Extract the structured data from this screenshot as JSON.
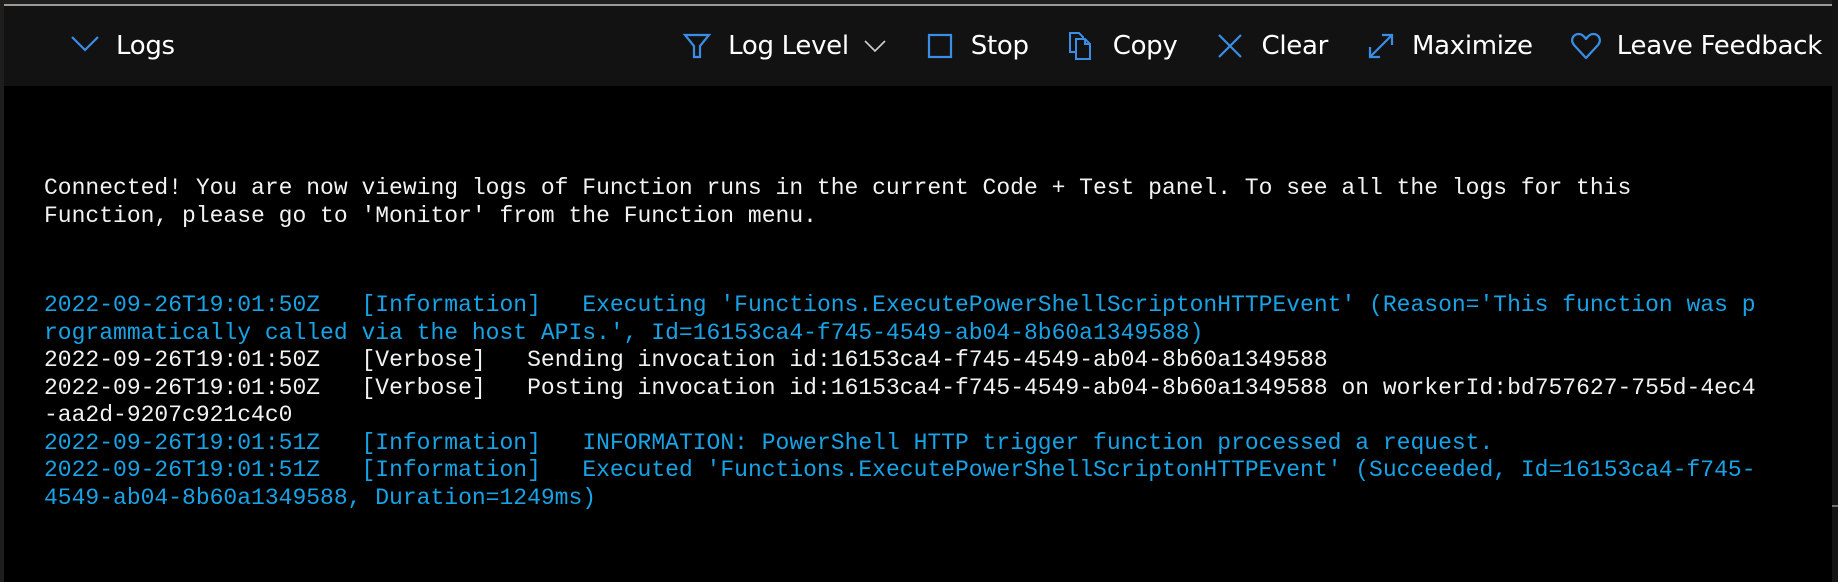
{
  "toolbar": {
    "collapse": {
      "icon": "chevron-down-icon",
      "label": "Logs"
    },
    "actions": [
      {
        "id": "log-level",
        "icon": "filter-icon",
        "label": "Log Level",
        "has_dropdown": true
      },
      {
        "id": "stop",
        "icon": "stop-square-icon",
        "label": "Stop"
      },
      {
        "id": "copy",
        "icon": "copy-icon",
        "label": "Copy"
      },
      {
        "id": "clear",
        "icon": "close-x-icon",
        "label": "Clear"
      },
      {
        "id": "maximize",
        "icon": "expand-arrows-icon",
        "label": "Maximize"
      },
      {
        "id": "feedback",
        "icon": "heart-icon",
        "label": "Leave Feedback"
      }
    ],
    "icon_color": "#3a8ee6"
  },
  "logs": {
    "intro": "Connected! You are now viewing logs of Function runs in the current Code + Test panel. To see all the logs for this Function, please go to 'Monitor' from the Function menu.",
    "entries": [
      {
        "timestamp": "2022-09-26T19:01:50Z",
        "level": "[Information]",
        "level_class": "info",
        "message": "Executing 'Functions.ExecutePowerShellScriptonHTTPEvent' (Reason='This function was programmatically called via the host APIs.', Id=16153ca4-f745-4549-ab04-8b60a1349588)"
      },
      {
        "timestamp": "2022-09-26T19:01:50Z",
        "level": "[Verbose]",
        "level_class": "verbose",
        "message": "Sending invocation id:16153ca4-f745-4549-ab04-8b60a1349588"
      },
      {
        "timestamp": "2022-09-26T19:01:50Z",
        "level": "[Verbose]",
        "level_class": "verbose",
        "message": "Posting invocation id:16153ca4-f745-4549-ab04-8b60a1349588 on workerId:bd757627-755d-4ec4-aa2d-9207c921c4c0"
      },
      {
        "timestamp": "2022-09-26T19:01:51Z",
        "level": "[Information]",
        "level_class": "info",
        "message": "INFORMATION: PowerShell HTTP trigger function processed a request."
      },
      {
        "timestamp": "2022-09-26T19:01:51Z",
        "level": "[Information]",
        "level_class": "info",
        "message": "Executed 'Functions.ExecutePowerShellScriptonHTTPEvent' (Succeeded, Id=16153ca4-f745-4549-ab04-8b60a1349588, Duration=1249ms)"
      }
    ],
    "colors": {
      "info": "#17a3e6",
      "verbose": "#f2f2f2"
    }
  }
}
